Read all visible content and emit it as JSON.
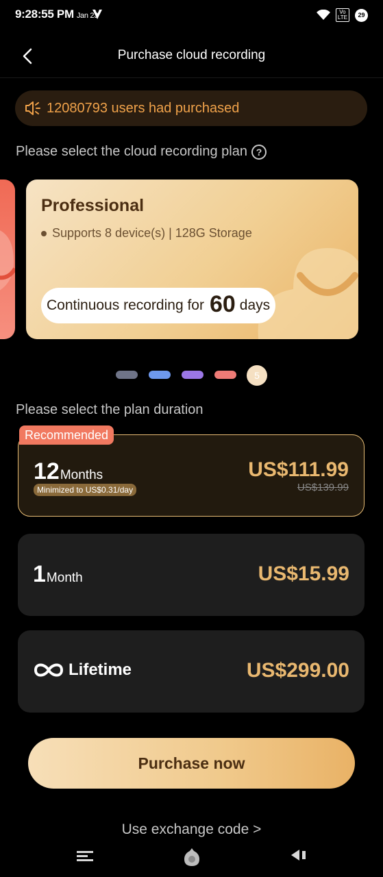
{
  "status_bar": {
    "time": "9:28:55 PM",
    "date": "Jan 23",
    "network_badge_top": "Vo",
    "network_badge_bottom": "LTE",
    "battery": "29",
    "icons": [
      "v-carrier-icon",
      "wifi-icon",
      "lte-icon",
      "battery-icon"
    ]
  },
  "header": {
    "title": "Purchase cloud recording",
    "back_icon": "chevron-left-icon"
  },
  "promo": {
    "text": "12080793 users had purchased",
    "icon": "speaker-icon"
  },
  "plan_section": {
    "label": "Please select the cloud recording plan",
    "help_icon_glyph": "?"
  },
  "plan_card": {
    "name": "Professional",
    "description": "Supports 8 device(s) | 128G Storage",
    "duration_prefix": "Continuous recording for",
    "duration_value": "60",
    "duration_unit": "days"
  },
  "pager": {
    "dot_colors": [
      "#6f7488",
      "#6e99ee",
      "#9b77e6",
      "#ee7b76"
    ],
    "active_label": "5"
  },
  "duration_section": {
    "label": "Please select the plan duration"
  },
  "durations": [
    {
      "badge": "Recommended",
      "count": "12",
      "unit": "Months",
      "hint": "Minimized to US$0.31/day",
      "price": "US$111.99",
      "old_price": "US$139.99",
      "selected": true
    },
    {
      "count": "1",
      "unit": "Month",
      "price": "US$15.99"
    },
    {
      "label": "Lifetime",
      "icon": "infinity-icon",
      "price": "US$299.00"
    }
  ],
  "purchase_button": "Purchase now",
  "exchange_link": "Use exchange code >",
  "colors": {
    "accent_gold": "#e9b870",
    "promo_text": "#f0a24a",
    "badge": "#f17960"
  },
  "system_nav": [
    "menu-icon",
    "home-icon",
    "back-icon"
  ]
}
